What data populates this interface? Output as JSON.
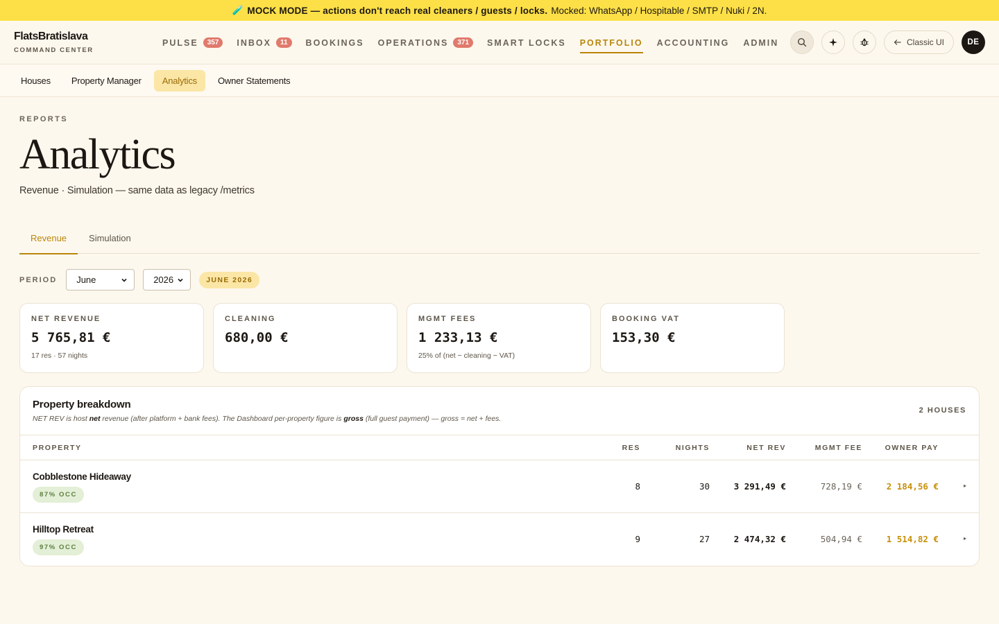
{
  "banner": {
    "icon": "🧪",
    "strong": "MOCK MODE — actions don't reach real cleaners / guests / locks.",
    "rest": "Mocked: WhatsApp / Hospitable / SMTP / Nuki / 2N."
  },
  "brand": {
    "name": "FlatsBratislava",
    "subtitle": "COMMAND CENTER"
  },
  "nav": {
    "items": [
      {
        "label": "PULSE",
        "badge": "357"
      },
      {
        "label": "INBOX",
        "badge": "11"
      },
      {
        "label": "BOOKINGS"
      },
      {
        "label": "OPERATIONS",
        "badge": "371"
      },
      {
        "label": "SMART LOCKS"
      },
      {
        "label": "PORTFOLIO",
        "active": true
      },
      {
        "label": "ACCOUNTING"
      },
      {
        "label": "ADMIN"
      }
    ]
  },
  "actions": {
    "classic_label": "Classic UI",
    "avatar": "DE"
  },
  "subnav": {
    "items": [
      "Houses",
      "Property Manager",
      "Analytics",
      "Owner Statements"
    ],
    "active": "Analytics"
  },
  "page": {
    "eyebrow": "REPORTS",
    "title": "Analytics",
    "subtitle": "Revenue · Simulation — same data as legacy /metrics"
  },
  "tabs": {
    "items": [
      "Revenue",
      "Simulation"
    ],
    "active": "Revenue"
  },
  "period": {
    "label": "PERIOD",
    "month": "June",
    "year": "2026",
    "badge": "JUNE 2026"
  },
  "stats": [
    {
      "label": "NET REVENUE",
      "value": "5 765,81 €",
      "note": "17 res · 57 nights"
    },
    {
      "label": "CLEANING",
      "value": "680,00 €",
      "note": ""
    },
    {
      "label": "MGMT FEES",
      "value": "1 233,13 €",
      "note": "25% of (net − cleaning − VAT)"
    },
    {
      "label": "BOOKING VAT",
      "value": "153,30 €",
      "note": ""
    }
  ],
  "breakdown": {
    "title": "Property breakdown",
    "desc_1": "NET REV is host ",
    "desc_bold_1": "net",
    "desc_2": " revenue (after platform + bank fees). The Dashboard per-property figure is ",
    "desc_bold_2": "gross",
    "desc_3": " (full guest payment) — gross = net + fees.",
    "count": "2 HOUSES",
    "columns": {
      "property": "PROPERTY",
      "res": "RES",
      "nights": "NIGHTS",
      "net_rev": "NET REV",
      "mgmt_fee": "MGMT FEE",
      "owner_pay": "OWNER PAY"
    },
    "rows": [
      {
        "name": "Cobblestone Hideaway",
        "occ": "87% OCC",
        "res": "8",
        "nights": "30",
        "net_rev": "3 291,49 €",
        "mgmt_fee": "728,19 €",
        "owner_pay": "2 184,56 €",
        "arrow": "▸"
      },
      {
        "name": "Hilltop Retreat",
        "occ": "97% OCC",
        "res": "9",
        "nights": "27",
        "net_rev": "2 474,32 €",
        "mgmt_fee": "504,94 €",
        "owner_pay": "1 514,82 €",
        "arrow": "▸"
      }
    ]
  }
}
